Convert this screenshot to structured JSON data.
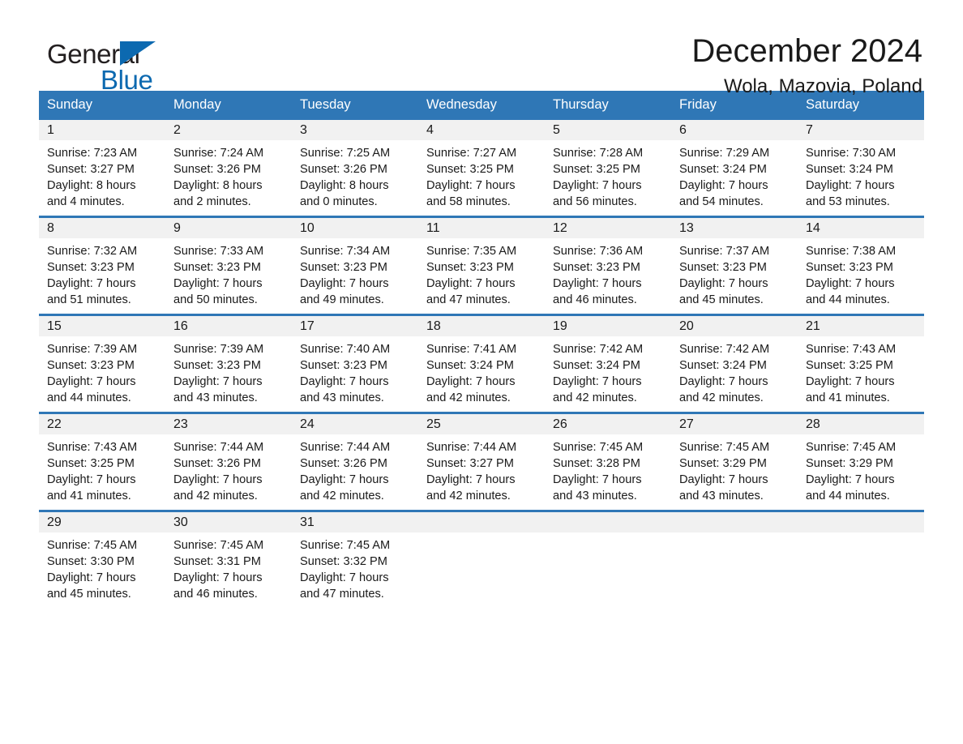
{
  "brand": {
    "name_part1": "General",
    "name_part2": "Blue",
    "triangle_icon": "triangle-icon",
    "colors": {
      "black": "#231f20",
      "blue": "#0c69b0"
    }
  },
  "header": {
    "month_title": "December 2024",
    "location": "Wola, Mazovia, Poland"
  },
  "theme": {
    "header_blue": "#2f77b6",
    "row_divider_blue": "#2f77b6",
    "daynum_band": "#f1f1f1",
    "text": "#1a1a1a"
  },
  "weekday_headers": [
    "Sunday",
    "Monday",
    "Tuesday",
    "Wednesday",
    "Thursday",
    "Friday",
    "Saturday"
  ],
  "labels": {
    "sunrise_prefix": "Sunrise:",
    "sunset_prefix": "Sunset:",
    "daylight_prefix": "Daylight:"
  },
  "weeks": [
    [
      {
        "day": "1",
        "sunrise": "Sunrise: 7:23 AM",
        "sunset": "Sunset: 3:27 PM",
        "daylight_line1": "Daylight: 8 hours",
        "daylight_line2": "and 4 minutes."
      },
      {
        "day": "2",
        "sunrise": "Sunrise: 7:24 AM",
        "sunset": "Sunset: 3:26 PM",
        "daylight_line1": "Daylight: 8 hours",
        "daylight_line2": "and 2 minutes."
      },
      {
        "day": "3",
        "sunrise": "Sunrise: 7:25 AM",
        "sunset": "Sunset: 3:26 PM",
        "daylight_line1": "Daylight: 8 hours",
        "daylight_line2": "and 0 minutes."
      },
      {
        "day": "4",
        "sunrise": "Sunrise: 7:27 AM",
        "sunset": "Sunset: 3:25 PM",
        "daylight_line1": "Daylight: 7 hours",
        "daylight_line2": "and 58 minutes."
      },
      {
        "day": "5",
        "sunrise": "Sunrise: 7:28 AM",
        "sunset": "Sunset: 3:25 PM",
        "daylight_line1": "Daylight: 7 hours",
        "daylight_line2": "and 56 minutes."
      },
      {
        "day": "6",
        "sunrise": "Sunrise: 7:29 AM",
        "sunset": "Sunset: 3:24 PM",
        "daylight_line1": "Daylight: 7 hours",
        "daylight_line2": "and 54 minutes."
      },
      {
        "day": "7",
        "sunrise": "Sunrise: 7:30 AM",
        "sunset": "Sunset: 3:24 PM",
        "daylight_line1": "Daylight: 7 hours",
        "daylight_line2": "and 53 minutes."
      }
    ],
    [
      {
        "day": "8",
        "sunrise": "Sunrise: 7:32 AM",
        "sunset": "Sunset: 3:23 PM",
        "daylight_line1": "Daylight: 7 hours",
        "daylight_line2": "and 51 minutes."
      },
      {
        "day": "9",
        "sunrise": "Sunrise: 7:33 AM",
        "sunset": "Sunset: 3:23 PM",
        "daylight_line1": "Daylight: 7 hours",
        "daylight_line2": "and 50 minutes."
      },
      {
        "day": "10",
        "sunrise": "Sunrise: 7:34 AM",
        "sunset": "Sunset: 3:23 PM",
        "daylight_line1": "Daylight: 7 hours",
        "daylight_line2": "and 49 minutes."
      },
      {
        "day": "11",
        "sunrise": "Sunrise: 7:35 AM",
        "sunset": "Sunset: 3:23 PM",
        "daylight_line1": "Daylight: 7 hours",
        "daylight_line2": "and 47 minutes."
      },
      {
        "day": "12",
        "sunrise": "Sunrise: 7:36 AM",
        "sunset": "Sunset: 3:23 PM",
        "daylight_line1": "Daylight: 7 hours",
        "daylight_line2": "and 46 minutes."
      },
      {
        "day": "13",
        "sunrise": "Sunrise: 7:37 AM",
        "sunset": "Sunset: 3:23 PM",
        "daylight_line1": "Daylight: 7 hours",
        "daylight_line2": "and 45 minutes."
      },
      {
        "day": "14",
        "sunrise": "Sunrise: 7:38 AM",
        "sunset": "Sunset: 3:23 PM",
        "daylight_line1": "Daylight: 7 hours",
        "daylight_line2": "and 44 minutes."
      }
    ],
    [
      {
        "day": "15",
        "sunrise": "Sunrise: 7:39 AM",
        "sunset": "Sunset: 3:23 PM",
        "daylight_line1": "Daylight: 7 hours",
        "daylight_line2": "and 44 minutes."
      },
      {
        "day": "16",
        "sunrise": "Sunrise: 7:39 AM",
        "sunset": "Sunset: 3:23 PM",
        "daylight_line1": "Daylight: 7 hours",
        "daylight_line2": "and 43 minutes."
      },
      {
        "day": "17",
        "sunrise": "Sunrise: 7:40 AM",
        "sunset": "Sunset: 3:23 PM",
        "daylight_line1": "Daylight: 7 hours",
        "daylight_line2": "and 43 minutes."
      },
      {
        "day": "18",
        "sunrise": "Sunrise: 7:41 AM",
        "sunset": "Sunset: 3:24 PM",
        "daylight_line1": "Daylight: 7 hours",
        "daylight_line2": "and 42 minutes."
      },
      {
        "day": "19",
        "sunrise": "Sunrise: 7:42 AM",
        "sunset": "Sunset: 3:24 PM",
        "daylight_line1": "Daylight: 7 hours",
        "daylight_line2": "and 42 minutes."
      },
      {
        "day": "20",
        "sunrise": "Sunrise: 7:42 AM",
        "sunset": "Sunset: 3:24 PM",
        "daylight_line1": "Daylight: 7 hours",
        "daylight_line2": "and 42 minutes."
      },
      {
        "day": "21",
        "sunrise": "Sunrise: 7:43 AM",
        "sunset": "Sunset: 3:25 PM",
        "daylight_line1": "Daylight: 7 hours",
        "daylight_line2": "and 41 minutes."
      }
    ],
    [
      {
        "day": "22",
        "sunrise": "Sunrise: 7:43 AM",
        "sunset": "Sunset: 3:25 PM",
        "daylight_line1": "Daylight: 7 hours",
        "daylight_line2": "and 41 minutes."
      },
      {
        "day": "23",
        "sunrise": "Sunrise: 7:44 AM",
        "sunset": "Sunset: 3:26 PM",
        "daylight_line1": "Daylight: 7 hours",
        "daylight_line2": "and 42 minutes."
      },
      {
        "day": "24",
        "sunrise": "Sunrise: 7:44 AM",
        "sunset": "Sunset: 3:26 PM",
        "daylight_line1": "Daylight: 7 hours",
        "daylight_line2": "and 42 minutes."
      },
      {
        "day": "25",
        "sunrise": "Sunrise: 7:44 AM",
        "sunset": "Sunset: 3:27 PM",
        "daylight_line1": "Daylight: 7 hours",
        "daylight_line2": "and 42 minutes."
      },
      {
        "day": "26",
        "sunrise": "Sunrise: 7:45 AM",
        "sunset": "Sunset: 3:28 PM",
        "daylight_line1": "Daylight: 7 hours",
        "daylight_line2": "and 43 minutes."
      },
      {
        "day": "27",
        "sunrise": "Sunrise: 7:45 AM",
        "sunset": "Sunset: 3:29 PM",
        "daylight_line1": "Daylight: 7 hours",
        "daylight_line2": "and 43 minutes."
      },
      {
        "day": "28",
        "sunrise": "Sunrise: 7:45 AM",
        "sunset": "Sunset: 3:29 PM",
        "daylight_line1": "Daylight: 7 hours",
        "daylight_line2": "and 44 minutes."
      }
    ],
    [
      {
        "day": "29",
        "sunrise": "Sunrise: 7:45 AM",
        "sunset": "Sunset: 3:30 PM",
        "daylight_line1": "Daylight: 7 hours",
        "daylight_line2": "and 45 minutes."
      },
      {
        "day": "30",
        "sunrise": "Sunrise: 7:45 AM",
        "sunset": "Sunset: 3:31 PM",
        "daylight_line1": "Daylight: 7 hours",
        "daylight_line2": "and 46 minutes."
      },
      {
        "day": "31",
        "sunrise": "Sunrise: 7:45 AM",
        "sunset": "Sunset: 3:32 PM",
        "daylight_line1": "Daylight: 7 hours",
        "daylight_line2": "and 47 minutes."
      },
      {
        "day": "",
        "sunrise": "",
        "sunset": "",
        "daylight_line1": "",
        "daylight_line2": ""
      },
      {
        "day": "",
        "sunrise": "",
        "sunset": "",
        "daylight_line1": "",
        "daylight_line2": ""
      },
      {
        "day": "",
        "sunrise": "",
        "sunset": "",
        "daylight_line1": "",
        "daylight_line2": ""
      },
      {
        "day": "",
        "sunrise": "",
        "sunset": "",
        "daylight_line1": "",
        "daylight_line2": ""
      }
    ]
  ]
}
